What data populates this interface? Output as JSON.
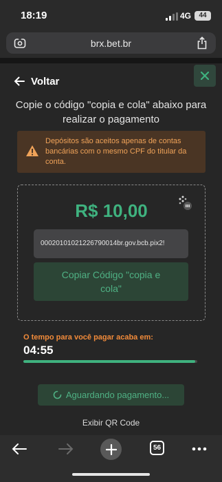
{
  "status_bar": {
    "time": "18:19",
    "network": "4G",
    "battery": "44"
  },
  "browser": {
    "url": "brx.bet.br",
    "tab_count": "56"
  },
  "header": {
    "back_label": "Voltar"
  },
  "instruction": "Copie o código \"copia e cola\" abaixo para realizar o pagamento",
  "warning": "Depósitos são aceitos apenas de contas bancárias com o mesmo CPF do titular da conta.",
  "payment": {
    "amount": "R$ 10,00",
    "pix_code": "00020101021226790014br.gov.bcb.pix2!",
    "copy_button_label": "Copiar Código \"copia e cola\""
  },
  "timer": {
    "label": "O tempo para você pagar acaba em:",
    "value": "04:55",
    "progress": 0.99
  },
  "waiting_label": "Aguardando pagamento...",
  "qr_link_label": "Exibir QR Code",
  "colors": {
    "accent_green": "#3fb27f",
    "warning_orange": "#f0a359",
    "timer_orange": "#f28b3a",
    "background": "#262626"
  }
}
